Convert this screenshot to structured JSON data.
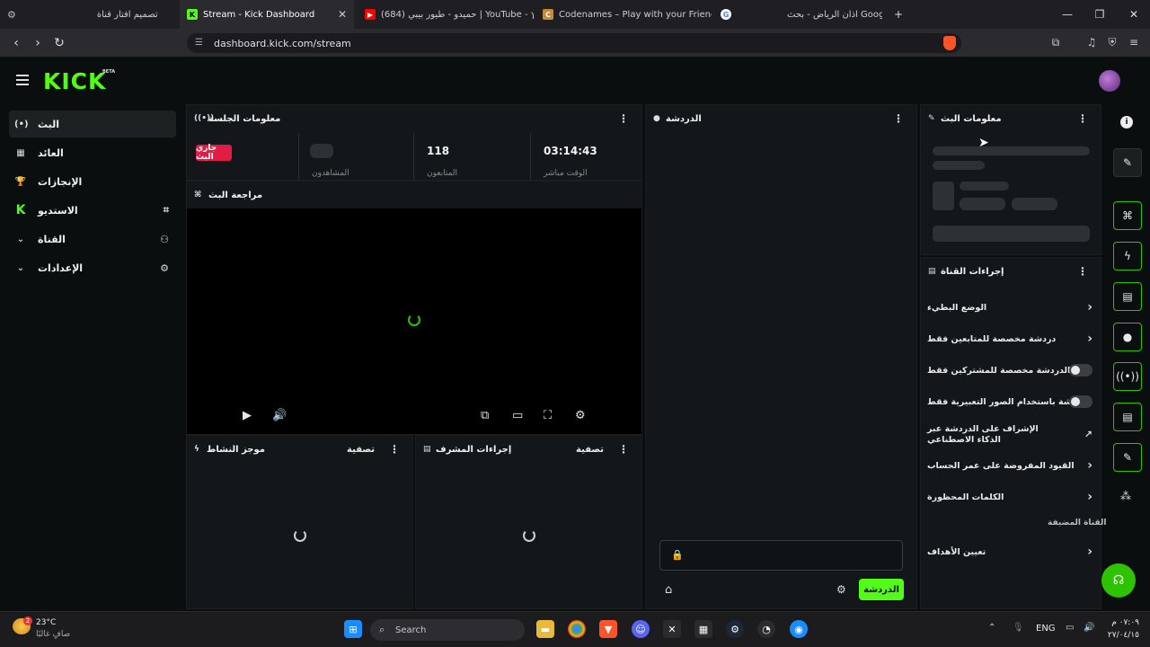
{
  "browser": {
    "tabs": [
      {
        "label": "تصميم افتار قناة",
        "active": false
      },
      {
        "label": "Stream - Kick Dashboard",
        "active": true
      },
      {
        "label": "(684) حميدو - طيور بيبي | YouTube - ץ",
        "active": false
      },
      {
        "label": "Codenames – Play with your Friends",
        "active": false
      },
      {
        "label": "اذان الرياض - بحث Google",
        "active": false
      }
    ],
    "new_tab": "+",
    "url": "dashboard.kick.com/stream"
  },
  "app": {
    "logo": "KICK",
    "logo_badge": "BETA"
  },
  "sidebar": {
    "items": [
      {
        "label": "البث",
        "icon": "(•)"
      },
      {
        "label": "العائد",
        "icon": "▦"
      },
      {
        "label": "الإنجازات",
        "icon": "🏆"
      },
      {
        "label": "الاستديو",
        "icon": "⌘"
      },
      {
        "label": "القناة",
        "icon": "▾"
      },
      {
        "label": "الإعدادات",
        "icon": "▾"
      }
    ]
  },
  "session_panel": {
    "title": "معلومات الجلسة",
    "live_badge": "جاري البث",
    "viewers_value": "",
    "viewers_label": "المشاهدون",
    "followers_value": "118",
    "followers_label": "المتابعون",
    "time_value": "03:14:43",
    "time_label": "الوقت مباشر"
  },
  "preview_panel": {
    "title": "مراجعة البث"
  },
  "activity_panel": {
    "title": "موجز النشاط",
    "filter": "تصفية"
  },
  "mod_panel": {
    "title": "إجراءات المشرف",
    "filter": "تصفية"
  },
  "chat_panel": {
    "title": "الدردشة",
    "send_label": "الدردشة"
  },
  "stream_info_panel": {
    "title": "معلومات البث"
  },
  "channel_actions": {
    "title": "إجراءات القناة",
    "rows": [
      {
        "label": "الوضع البطيء",
        "control": "chevron"
      },
      {
        "label": "دردشة مخصصة للمتابعين فقط",
        "control": "chevron"
      },
      {
        "label": "الدردشة مخصصة للمشتركين فقط",
        "control": "toggle"
      },
      {
        "label": "الدردشة باستخدام الصور التعبيرية فقط",
        "control": "toggle"
      },
      {
        "label": "الإشراف على الدردشة عبر الذكاء الاصطناعي",
        "control": "external"
      },
      {
        "label": "القيود المفروضة على عمر الحساب",
        "control": "chevron"
      },
      {
        "label": "الكلمات المحظورة",
        "control": "chevron"
      }
    ],
    "section_label": "القناة المضيفة",
    "host_row": "تعيين الأهداف"
  },
  "taskbar": {
    "weather_temp": "23°C",
    "weather_desc": "صافٍ غالبًا",
    "weather_badge": "2",
    "search_label": "Search",
    "lang": "ENG",
    "time": "٠٧:٠٩ م",
    "date": "٢٧/٠٤/١٥"
  }
}
